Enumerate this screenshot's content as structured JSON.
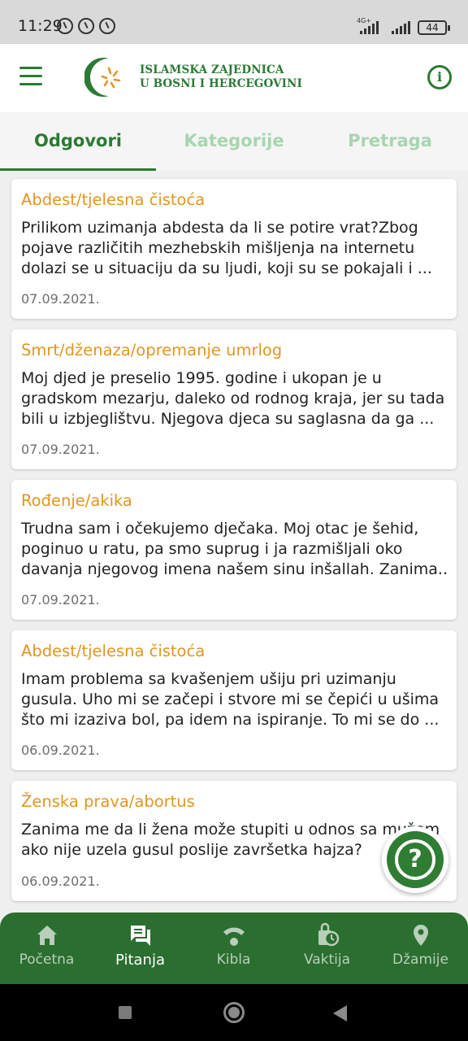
{
  "status_bar": {
    "time": "11:29",
    "network": "4G+",
    "battery": "44"
  },
  "app_bar": {
    "logo_line1": "ISLAMSKA ZAJEDNICA",
    "logo_line2": "U BOSNI I HERCEGOVINI",
    "brand_color": "#2b7a33",
    "menu_icon": "menu-icon",
    "info_icon": "info-icon"
  },
  "tabs": [
    {
      "label": "Odgovori",
      "active": true
    },
    {
      "label": "Kategorije",
      "active": false
    },
    {
      "label": "Pretraga",
      "active": false
    }
  ],
  "cards": [
    {
      "category": "Abdest/tjelesna čistoća",
      "lines": [
        "Prilikom uzimanja abdesta da li se potire vrat?Zbog",
        "pojave različitih mezhebskih mišljenja na internetu",
        "dolazi se u situaciju da su ljudi, koji su se pokajali i ..."
      ],
      "date": "07.09.2021."
    },
    {
      "category": "Smrt/dženaza/opremanje umrlog",
      "lines": [
        "Moj djed je preselio 1995. godine i ukopan je u",
        "gradskom mezarju, daleko od rodnog kraja, jer su tada",
        "bili u izbjeglištvu. Njegova djeca su saglasna da ga ..."
      ],
      "date": "07.09.2021."
    },
    {
      "category": "Rođenje/akika",
      "lines": [
        "Trudna sam i očekujemo dječaka. Moj otac je šehid,",
        "poginuo u ratu, pa smo suprug i ja razmišljali oko",
        "davanja njegovog imena našem sinu inšallah. Zanima..."
      ],
      "date": "07.09.2021."
    },
    {
      "category": "Abdest/tjelesna čistoća",
      "lines": [
        "Imam problema sa kvašenjem ušiju pri uzimanju",
        "gusula. Uho mi se začepi i stvore mi se čepići u ušima",
        "što mi izaziva bol, pa idem na ispiranje. To mi se do ..."
      ],
      "date": "06.09.2021."
    },
    {
      "category": "Ženska prava/abortus",
      "lines": [
        "Zanima me da li žena može stupiti u odnos sa mužem",
        "ako nije uzela gusul poslije završetka hajza?"
      ],
      "date": "06.09.2021."
    }
  ],
  "fab": {
    "icon": "help-icon",
    "glyph": "?"
  },
  "bottom_nav": [
    {
      "label": "Početna",
      "icon": "home-icon",
      "active": false
    },
    {
      "label": "Pitanja",
      "icon": "chat-icon",
      "active": true
    },
    {
      "label": "Kibla",
      "icon": "compass-icon",
      "active": false
    },
    {
      "label": "Vaktija",
      "icon": "clock-icon",
      "active": false
    },
    {
      "label": "Džamije",
      "icon": "location-icon",
      "active": false
    }
  ],
  "colors": {
    "accent_orange": "#e3961e",
    "tab_inactive": "#a8d5b0",
    "bottom_nav_bg": "#2a6e30"
  }
}
